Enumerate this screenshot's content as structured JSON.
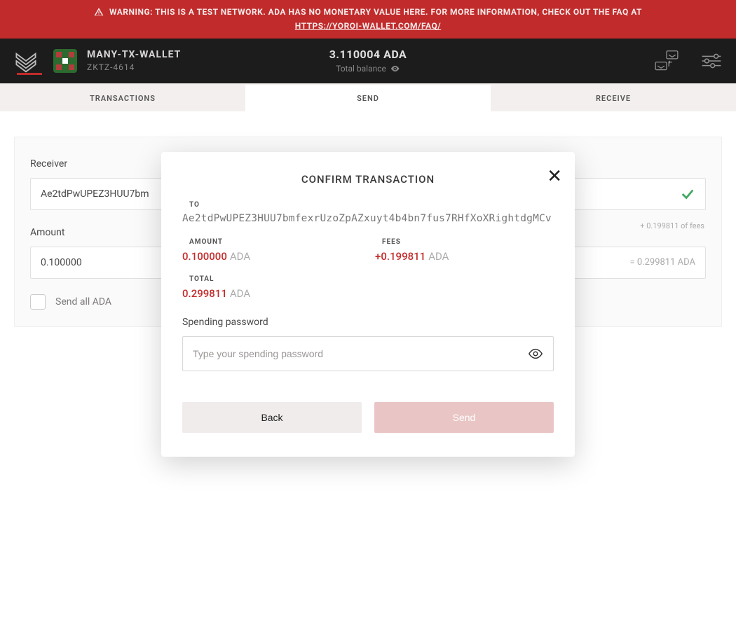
{
  "warning": {
    "text": "WARNING: THIS IS A TEST NETWORK. ADA HAS NO MONETARY VALUE HERE. FOR MORE INFORMATION, CHECK OUT THE FAQ AT",
    "link": "HTTPS://YOROI-WALLET.COM/FAQ/"
  },
  "header": {
    "wallet_name": "MANY-TX-WALLET",
    "wallet_id": "ZKTZ-4614",
    "balance": "3.110004 ADA",
    "balance_label": "Total balance"
  },
  "tabs": {
    "transactions": "TRANSACTIONS",
    "send": "SEND",
    "receive": "RECEIVE"
  },
  "form": {
    "receiver_label": "Receiver",
    "receiver_value": "Ae2tdPwUPEZ3HUU7bm",
    "amount_label": "Amount",
    "amount_value": "0.100000",
    "fee_note": "+ 0.199811 of fees",
    "eq_note": "= 0.299811 ADA",
    "send_all_label": "Send all ADA"
  },
  "modal": {
    "title": "CONFIRM TRANSACTION",
    "to_label": "TO",
    "to_value": "Ae2tdPwUPEZ3HUU7bmfexrUzoZpAZxuyt4b4bn7fus7RHfXoXRightdgMCv",
    "amount_label": "AMOUNT",
    "amount_value": "0.100000",
    "fees_label": "FEES",
    "fees_value": "+0.199811",
    "total_label": "TOTAL",
    "total_value": "0.299811",
    "currency": "ADA",
    "password_label": "Spending password",
    "password_placeholder": "Type your spending password",
    "back_label": "Back",
    "send_label": "Send"
  },
  "colors": {
    "accent_red": "#c12b2b",
    "header_bg": "#1c1c1c"
  }
}
